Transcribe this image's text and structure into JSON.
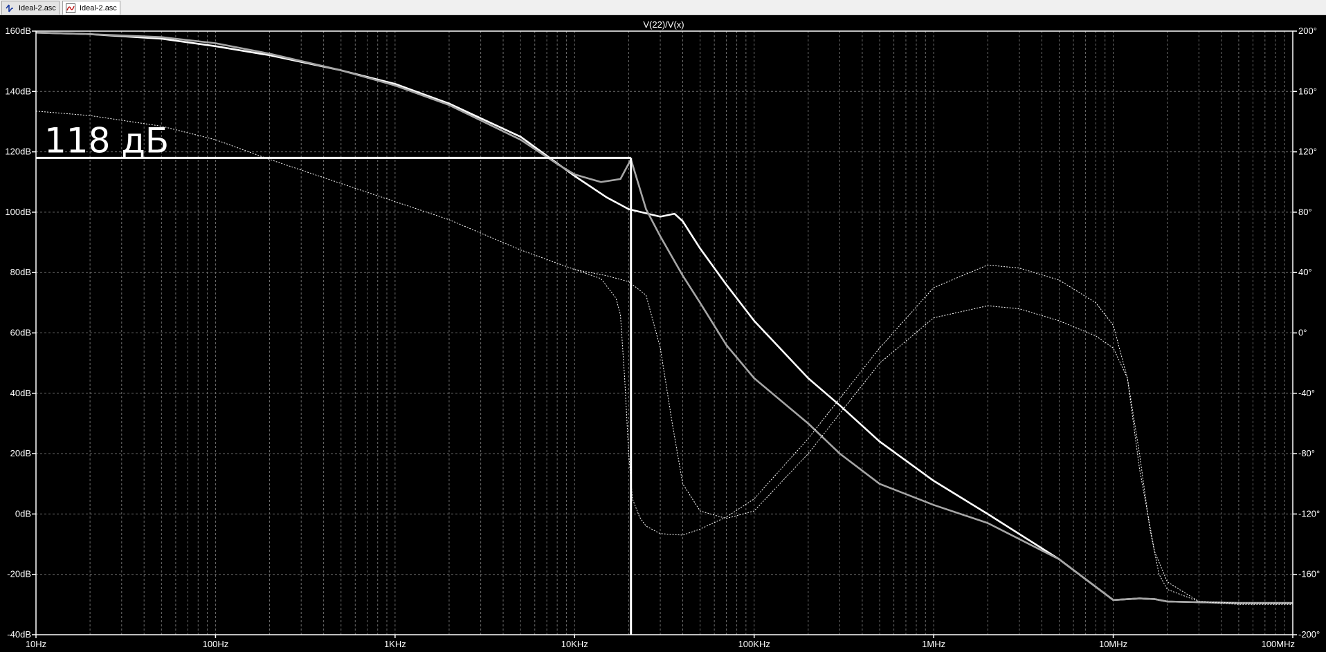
{
  "tabs": [
    {
      "label": "Ideal-2.asc",
      "icon": "schematic-icon",
      "active": false
    },
    {
      "label": "Ideal-2.asc",
      "icon": "waveform-icon",
      "active": true
    }
  ],
  "plot": {
    "title": "V(22)/V(x)",
    "annotation": "118 дБ",
    "colors": {
      "background": "#000000",
      "grid": "#6e6e6e",
      "frame": "#ffffff",
      "trace": "#ffffff",
      "trace_dim": "#a6a6a6"
    }
  },
  "chart_data": {
    "type": "line",
    "title": "V(22)/V(x)",
    "x_scale": "log",
    "xlim": [
      10,
      100000000
    ],
    "x_ticks": [
      "10Hz",
      "100Hz",
      "1KHz",
      "10KHz",
      "100KHz",
      "1MHz",
      "10MHz",
      "100MHz"
    ],
    "y_left_lim": [
      -40,
      160
    ],
    "y_left_ticks": [
      "160dB",
      "140dB",
      "120dB",
      "100dB",
      "80dB",
      "60dB",
      "40dB",
      "20dB",
      "0dB",
      "-20dB",
      "-40dB"
    ],
    "y_right_lim": [
      -200,
      200
    ],
    "y_right_ticks": [
      "200°",
      "160°",
      "120°",
      "80°",
      "40°",
      "0°",
      "-40°",
      "-80°",
      "-120°",
      "-160°",
      "-200°"
    ],
    "grid": true,
    "annotations": [
      {
        "text": "118 дБ",
        "y_db": 118
      },
      {
        "cursor_x_hz": 20600,
        "cursor_y_db": 118
      }
    ],
    "series": [
      {
        "axis": "left",
        "style": "solid",
        "color": "#ffffff",
        "x": [
          10,
          20,
          50,
          100,
          200,
          500,
          1000,
          2000,
          5000,
          10000,
          15000,
          20000,
          30000,
          36000,
          40000,
          50000,
          70000,
          100000,
          200000,
          300000,
          500000,
          1000000,
          2000000,
          5000000,
          10000000,
          14000000,
          17000000,
          20000000,
          50000000,
          100000000
        ],
        "y": [
          159.5,
          159,
          157.5,
          155,
          152,
          147,
          142.5,
          136,
          125,
          112,
          105,
          101,
          98.5,
          99.5,
          97,
          88,
          76,
          64,
          45,
          36,
          24,
          11,
          0,
          -15,
          -28.5,
          -28,
          -28.2,
          -29,
          -29.5,
          -29.5
        ]
      },
      {
        "axis": "left",
        "style": "solid",
        "color": "#a6a6a6",
        "x": [
          10,
          20,
          50,
          100,
          200,
          500,
          1000,
          2000,
          5000,
          8000,
          10000,
          14000,
          18000,
          20600,
          25000,
          30000,
          40000,
          50000,
          70000,
          100000,
          200000,
          300000,
          500000,
          1000000,
          2000000,
          5000000,
          10000000,
          14000000,
          17000000,
          20000000,
          50000000,
          100000000
        ],
        "y": [
          159.5,
          159,
          158,
          156,
          152.5,
          147,
          142,
          135.5,
          124,
          116,
          112.5,
          110,
          111,
          117.5,
          101,
          92,
          79,
          70,
          56,
          45,
          30,
          20,
          10,
          3,
          -3,
          -15,
          -28.5,
          -28,
          -28.2,
          -29,
          -29.5,
          -29.5
        ]
      },
      {
        "axis": "right",
        "style": "dashed",
        "color": "#ffffff",
        "x": [
          10,
          20,
          50,
          100,
          200,
          500,
          1000,
          2000,
          5000,
          10000,
          14000,
          17000,
          18000,
          19000,
          20000,
          21000,
          23000,
          25000,
          30000,
          40000,
          50000,
          70000,
          100000,
          200000,
          500000,
          1000000,
          2000000,
          3000000,
          5000000,
          8000000,
          10000000,
          12000000,
          14000000,
          17000000,
          20000000,
          30000000,
          50000000,
          100000000
        ],
        "y": [
          147,
          144,
          137,
          128,
          115,
          99,
          87,
          75,
          55,
          42,
          36,
          23,
          12,
          -30,
          -80,
          -110,
          -122,
          -128,
          -133,
          -134,
          -130,
          -122,
          -110,
          -70,
          -10,
          30,
          45,
          43,
          35,
          20,
          5,
          -30,
          -90,
          -145,
          -165,
          -178,
          -180,
          -180
        ]
      },
      {
        "axis": "right",
        "style": "dashed",
        "color": "#ffffff",
        "x": [
          10000,
          15000,
          20000,
          25000,
          30000,
          35000,
          40000,
          50000,
          70000,
          100000,
          200000,
          500000,
          1000000,
          2000000,
          3000000,
          5000000,
          8000000,
          10000000,
          12000000,
          14000000,
          16000000,
          18000000,
          20000000,
          30000000,
          50000000,
          100000000
        ],
        "y": [
          42,
          38,
          34,
          25,
          -10,
          -60,
          -100,
          -118,
          -123,
          -118,
          -80,
          -20,
          10,
          18,
          16,
          8,
          -2,
          -10,
          -30,
          -80,
          -130,
          -160,
          -170,
          -178,
          -179,
          -179
        ]
      }
    ]
  }
}
